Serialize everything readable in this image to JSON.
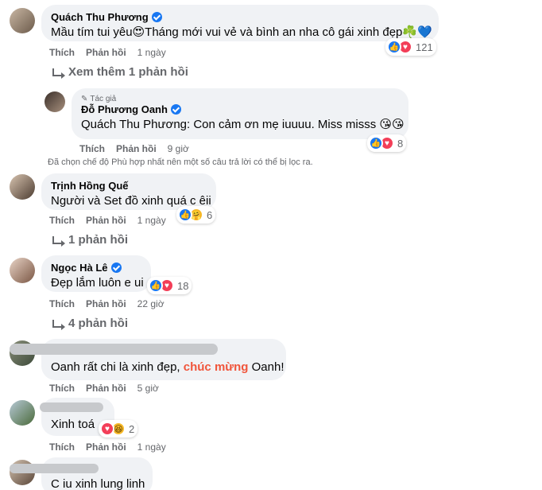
{
  "actions": {
    "like": "Thích",
    "reply": "Phản hồi"
  },
  "comments": [
    {
      "name": "Quách Thu Phương",
      "verified": true,
      "text": "Mầu tím tui yêu😍Tháng mới vui vẻ và bình an nha cô gái xinh đẹp☘️💙",
      "time": "1 ngày",
      "reaction_count": "121",
      "reactions": [
        "like-icon",
        "heart-icon"
      ],
      "view_more": "Xem thêm 1 phản hồi"
    },
    {
      "author_tag": "Tác giả",
      "name": "Đỗ Phương Oanh",
      "verified": true,
      "mention": "Quách Thu Phương",
      "text": ": Con cảm ơn mẹ iuuuu. Miss misss 😘😘",
      "time": "9 giờ",
      "reaction_count": "8",
      "reactions": [
        "like-icon",
        "heart-icon"
      ]
    },
    {
      "filter_note": "Đã chọn chế độ Phù hợp nhất nên một số câu trả lời có thể bị lọc ra."
    },
    {
      "name": "Trịnh Hồng Quế",
      "text": "Người và Set đồ xinh quá c êii",
      "time": "1 ngày",
      "reaction_count": "6",
      "reactions": [
        "like-icon",
        "care-icon"
      ],
      "replies": "1 phản hồi"
    },
    {
      "name": "Ngọc Hà Lê",
      "verified": true,
      "text": "Đẹp lắm luôn e ui",
      "time": "22 giờ",
      "reaction_count": "18",
      "reactions": [
        "like-icon",
        "heart-icon"
      ],
      "replies": "4 phản hồi"
    },
    {
      "text_before": "Oanh rất chi là xinh đẹp, ",
      "text_highlight": "chúc mừng",
      "text_after": " Oanh!",
      "time": "5 giờ"
    },
    {
      "text": "Xinh toá",
      "time": "1 ngày",
      "reaction_count": "2",
      "reactions": [
        "heart-icon",
        "haha-icon"
      ]
    },
    {
      "text": "C iu xinh lung linh"
    }
  ]
}
